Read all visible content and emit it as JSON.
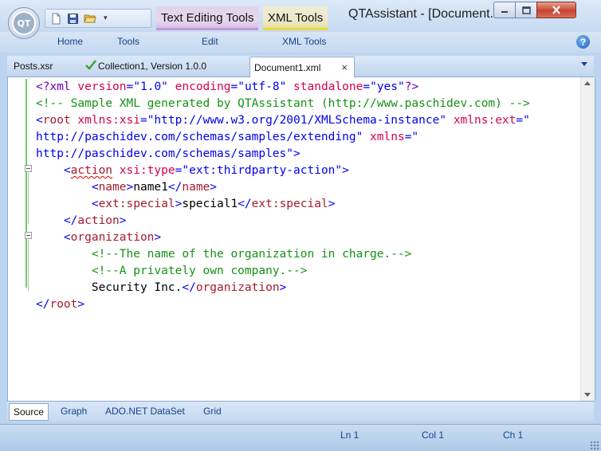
{
  "app": {
    "title": "QTAssistant - [Document...",
    "logo_text": "QT",
    "contextual_tabs": [
      "Text Editing Tools",
      "XML Tools"
    ],
    "accent_colors": {
      "text_tools": "#c397d6",
      "xml_tools": "#e7d84c"
    }
  },
  "quick_access": {
    "icons": [
      "new-document-icon",
      "save-icon",
      "open-folder-icon"
    ],
    "more_label": "▾"
  },
  "ribbon": {
    "tabs": [
      "Home",
      "Tools",
      "Edit",
      "XML Tools"
    ],
    "help_label": "?"
  },
  "doc_tabs": [
    {
      "label": "Posts.xsr",
      "icon": ""
    },
    {
      "label": "Collection1, Version 1.0.0",
      "icon": "checkmark-icon"
    },
    {
      "label": "Document1.xml",
      "icon": "",
      "active": true,
      "close_label": "×"
    }
  ],
  "editor": {
    "lines": [
      [
        [
          "pi",
          "<?"
        ],
        [
          "pi",
          "xml"
        ],
        [
          "attr",
          " version"
        ],
        [
          "punct",
          "="
        ],
        [
          "val",
          "\"1.0\""
        ],
        [
          "attr",
          " encoding"
        ],
        [
          "punct",
          "="
        ],
        [
          "val",
          "\"utf-8\""
        ],
        [
          "attr",
          " standalone"
        ],
        [
          "punct",
          "="
        ],
        [
          "val",
          "\"yes\""
        ],
        [
          "pi",
          "?>"
        ]
      ],
      [
        [
          "com",
          "<!-- Sample XML generated by QTAssistant (http://www.paschidev.com) -->"
        ]
      ],
      [
        [
          "punct",
          "<"
        ],
        [
          "tag",
          "root"
        ],
        [
          "attr",
          " xmlns:xsi"
        ],
        [
          "punct",
          "="
        ],
        [
          "val",
          "\"http://www.w3.org/2001/XMLSchema-instance\""
        ],
        [
          "attr",
          " xmlns:ext"
        ],
        [
          "punct",
          "=\""
        ]
      ],
      [
        [
          "val",
          "http://paschidev.com/schemas/samples/extending\""
        ],
        [
          "attr",
          " xmlns"
        ],
        [
          "punct",
          "=\""
        ]
      ],
      [
        [
          "val",
          "http://paschidev.com/schemas/samples\""
        ],
        [
          "punct",
          ">"
        ]
      ],
      [
        [
          "text",
          "    "
        ],
        [
          "punct",
          "<"
        ],
        [
          "tagsq",
          "action"
        ],
        [
          "attr",
          " xsi:type"
        ],
        [
          "punct",
          "="
        ],
        [
          "val",
          "\"ext:thirdparty-action\""
        ],
        [
          "punct",
          ">"
        ]
      ],
      [
        [
          "text",
          "        "
        ],
        [
          "punct",
          "<"
        ],
        [
          "tag",
          "name"
        ],
        [
          "punct",
          ">"
        ],
        [
          "text",
          "name1"
        ],
        [
          "punct",
          "</"
        ],
        [
          "tag",
          "name"
        ],
        [
          "punct",
          ">"
        ]
      ],
      [
        [
          "text",
          "        "
        ],
        [
          "punct",
          "<"
        ],
        [
          "tag",
          "ext:special"
        ],
        [
          "punct",
          ">"
        ],
        [
          "text",
          "special1"
        ],
        [
          "punct",
          "</"
        ],
        [
          "tag",
          "ext:special"
        ],
        [
          "punct",
          ">"
        ]
      ],
      [
        [
          "text",
          "    "
        ],
        [
          "punct",
          "</"
        ],
        [
          "tag",
          "action"
        ],
        [
          "punct",
          ">"
        ]
      ],
      [
        [
          "text",
          "    "
        ],
        [
          "punct",
          "<"
        ],
        [
          "tag",
          "organization"
        ],
        [
          "punct",
          ">"
        ]
      ],
      [
        [
          "text",
          "        "
        ],
        [
          "com",
          "<!--The name of the organization in charge.-->"
        ]
      ],
      [
        [
          "text",
          "        "
        ],
        [
          "com",
          "<!--A privately own company.-->"
        ]
      ],
      [
        [
          "text",
          "        "
        ],
        [
          "text",
          "Security Inc."
        ],
        [
          "punct",
          "</"
        ],
        [
          "tag",
          "organization"
        ],
        [
          "punct",
          ">"
        ]
      ],
      [
        [
          "punct",
          "</"
        ],
        [
          "tag",
          "root"
        ],
        [
          "punct",
          ">"
        ]
      ]
    ]
  },
  "view_tabs": [
    "Source",
    "Graph",
    "ADO.NET DataSet",
    "Grid"
  ],
  "status": {
    "ln": "Ln 1",
    "col": "Col 1",
    "ch": "Ch 1"
  }
}
